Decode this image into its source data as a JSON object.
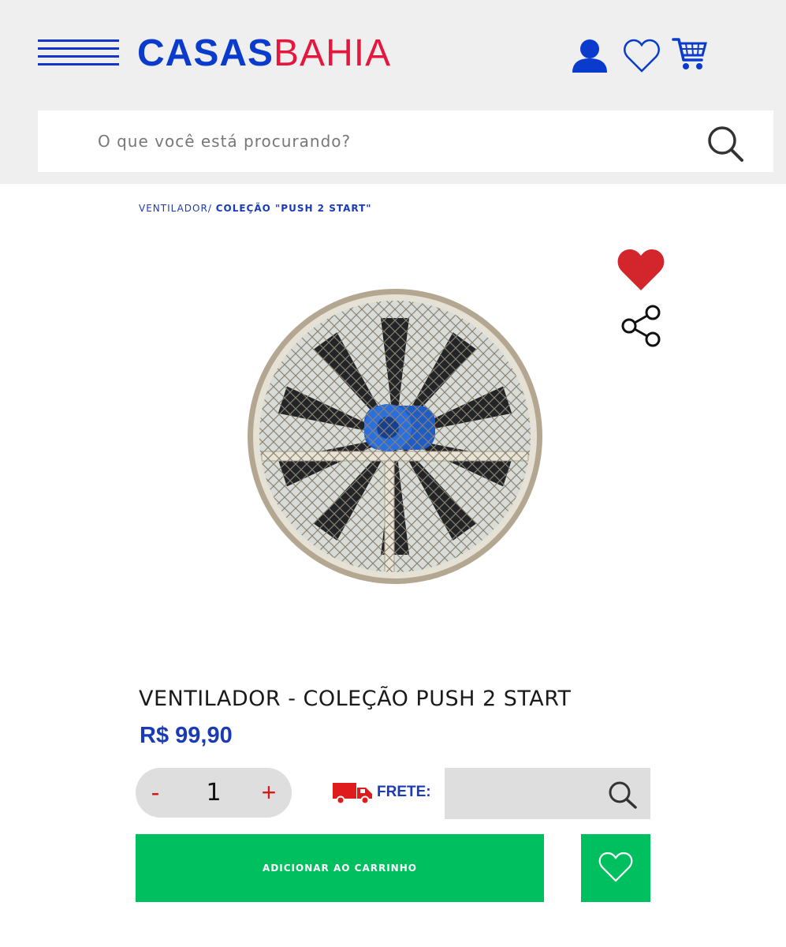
{
  "header": {
    "logo_part1": "CASAS",
    "logo_part2": "BAHIA",
    "icons": [
      "menu-icon",
      "user-icon",
      "heart-icon",
      "cart-icon"
    ],
    "brand_blue": "#0a3bcc",
    "brand_red": "#e5173f"
  },
  "search": {
    "placeholder": "O que você está procurando?"
  },
  "breadcrumb": {
    "parent": "VENTILADOR/",
    "current": "COLEÇÃO \"PUSH 2 START\""
  },
  "product": {
    "title": "VENTILADOR - COLEÇÃO PUSH 2 START",
    "price": "R$ 99,90",
    "image_icon": "industrial-fan-image",
    "favorited": true
  },
  "quantity": {
    "minus": "-",
    "value": "1",
    "plus": "+"
  },
  "shipping": {
    "label": "FRETE:",
    "value": ""
  },
  "actions": {
    "add_to_cart": "ADICIONAR AO CARRINHO"
  },
  "colors": {
    "primary_blue": "#1a3bb5",
    "accent_red": "#d31b1b",
    "cta_green": "#00bf5e"
  }
}
